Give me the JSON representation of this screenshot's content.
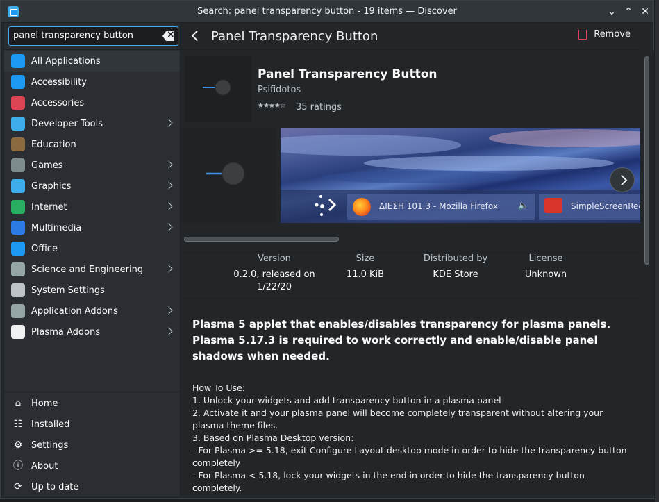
{
  "window": {
    "title": "Search: panel transparency button - 19 items — Discover"
  },
  "search": {
    "value": "panel transparency button"
  },
  "categories": [
    {
      "label": "All Applications",
      "icon": "grid-icon",
      "color": "#1d99f3",
      "has_children": false
    },
    {
      "label": "Accessibility",
      "icon": "accessibility-icon",
      "color": "#1d99f3",
      "has_children": false
    },
    {
      "label": "Accessories",
      "icon": "toolbox-icon",
      "color": "#da4453",
      "has_children": false
    },
    {
      "label": "Developer Tools",
      "icon": "developer-tools-icon",
      "color": "#3daee9",
      "has_children": true
    },
    {
      "label": "Education",
      "icon": "chalkboard-icon",
      "color": "#8a6a3e",
      "has_children": false
    },
    {
      "label": "Games",
      "icon": "gamepad-icon",
      "color": "#7f8c8d",
      "has_children": true
    },
    {
      "label": "Graphics",
      "icon": "graphics-icon",
      "color": "#3daee9",
      "has_children": true
    },
    {
      "label": "Internet",
      "icon": "globe-icon",
      "color": "#27ae60",
      "has_children": true
    },
    {
      "label": "Multimedia",
      "icon": "multimedia-icon",
      "color": "#2c7be5",
      "has_children": true
    },
    {
      "label": "Office",
      "icon": "office-icon",
      "color": "#1d99f3",
      "has_children": false
    },
    {
      "label": "Science and Engineering",
      "icon": "flask-icon",
      "color": "#95a5a6",
      "has_children": true
    },
    {
      "label": "System Settings",
      "icon": "system-settings-icon",
      "color": "#bdc3c7",
      "has_children": false
    },
    {
      "label": "Application Addons",
      "icon": "addons-icon",
      "color": "#95a5a6",
      "has_children": true
    },
    {
      "label": "Plasma Addons",
      "icon": "plasma-icon",
      "color": "#eff0f1",
      "has_children": true
    }
  ],
  "nav": [
    {
      "label": "Home",
      "icon": "home-icon"
    },
    {
      "label": "Installed",
      "icon": "installed-icon"
    },
    {
      "label": "Settings",
      "icon": "settings-icon"
    },
    {
      "label": "About",
      "icon": "info-icon"
    },
    {
      "label": "Up to date",
      "icon": "update-icon"
    }
  ],
  "page": {
    "title": "Panel Transparency Button",
    "remove_label": "Remove"
  },
  "app": {
    "name": "Panel Transparency Button",
    "author": "Psifidotos",
    "stars": "★★★★☆",
    "rating_count": "35 ratings"
  },
  "screenshot": {
    "task1_label": "ΔΙΕΣΗ 101.3 - Mozilla Firefox",
    "task2_label": "SimpleScreenRec"
  },
  "meta": {
    "version_label": "Version",
    "version_value": "0.2.0, released on 1/22/20",
    "size_label": "Size",
    "size_value": "11.0 KiB",
    "distributed_label": "Distributed by",
    "distributed_value": "KDE Store",
    "license_label": "License",
    "license_value": "Unknown"
  },
  "summary": "Plasma 5 applet that enables/disables transparency for plasma panels. Plasma 5.17.3 is required to work correctly and enable/disable panel shadows when needed.",
  "description": [
    "How To Use:",
    "1. Unlock your widgets and add transparency button in a plasma panel",
    "2. Activate it and your plasma panel will become completely transparent without altering your plasma theme files.",
    "3. Based on Plasma Desktop version:",
    "- For Plasma >= 5.18, exit Configure Layout desktop mode in order to hide the transparency button completely",
    "- For Plasma < 5.18, lock your widgets in the end in order to hide the transparency button completely."
  ],
  "colors": {
    "accent": "#3daee9",
    "remove": "#da4453"
  }
}
